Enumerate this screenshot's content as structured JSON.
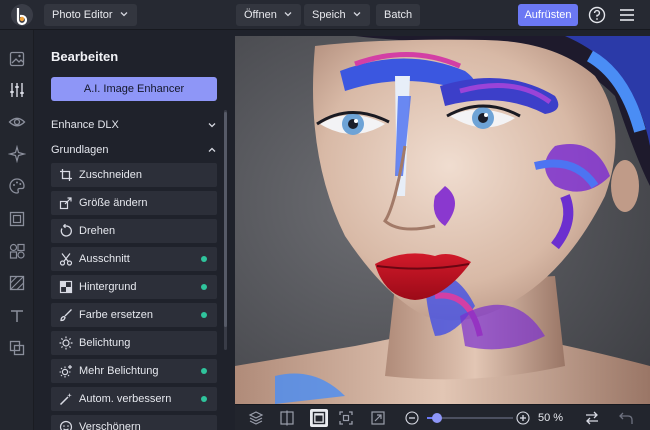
{
  "topbar": {
    "app_menu": "Photo Editor",
    "open": "Öffnen",
    "save": "Speich",
    "batch": "Batch",
    "upgrade": "Aufrüsten",
    "help_icon": "question-circle-icon",
    "menu_icon": "hamburger-menu-icon"
  },
  "rail": {
    "items": [
      {
        "name": "image-icon",
        "active": false
      },
      {
        "name": "adjust-sliders-icon",
        "active": true
      },
      {
        "name": "eye-icon",
        "active": false
      },
      {
        "name": "sparkles-icon",
        "active": false
      },
      {
        "name": "palette-icon",
        "active": false
      },
      {
        "name": "frame-icon",
        "active": false
      },
      {
        "name": "shapes-icon",
        "active": false
      },
      {
        "name": "texture-icon",
        "active": false
      },
      {
        "name": "text-icon",
        "active": false
      },
      {
        "name": "overlay-icon",
        "active": false
      }
    ]
  },
  "panel": {
    "title": "Bearbeiten",
    "ai_button": "A.I. Image Enhancer",
    "sections": [
      {
        "label": "Enhance DLX",
        "expanded": false
      },
      {
        "label": "Grundlagen",
        "expanded": true
      }
    ],
    "tools": [
      {
        "label": "Zuschneiden",
        "icon": "crop-icon",
        "new": false
      },
      {
        "label": "Größe ändern",
        "icon": "resize-icon",
        "new": false
      },
      {
        "label": "Drehen",
        "icon": "rotate-icon",
        "new": false
      },
      {
        "label": "Ausschnitt",
        "icon": "scissors-icon",
        "new": true
      },
      {
        "label": "Hintergrund",
        "icon": "background-icon",
        "new": true
      },
      {
        "label": "Farbe ersetzen",
        "icon": "brush-icon",
        "new": true
      },
      {
        "label": "Belichtung",
        "icon": "sun-icon",
        "new": false
      },
      {
        "label": "Mehr Belichtung",
        "icon": "sun-plus-icon",
        "new": true
      },
      {
        "label": "Autom. verbessern",
        "icon": "magic-wand-icon",
        "new": true
      },
      {
        "label": "Verschönern",
        "icon": "face-icon",
        "new": false
      }
    ]
  },
  "bottombar": {
    "icons": [
      "layers-icon",
      "compare-icon",
      "fit-icon",
      "actual-size-icon",
      "export-icon"
    ],
    "zoom_out_icon": "minus-icon",
    "zoom_in_icon": "plus-icon",
    "zoom_value": "50 %",
    "zoom_fraction": 0.12,
    "flip_icon": "swap-arrows-icon",
    "undo_icon": "undo-icon"
  },
  "colors": {
    "accent": "#6b78f4",
    "ai_button": "#8e96f7",
    "new_dot": "#2fc49c"
  }
}
